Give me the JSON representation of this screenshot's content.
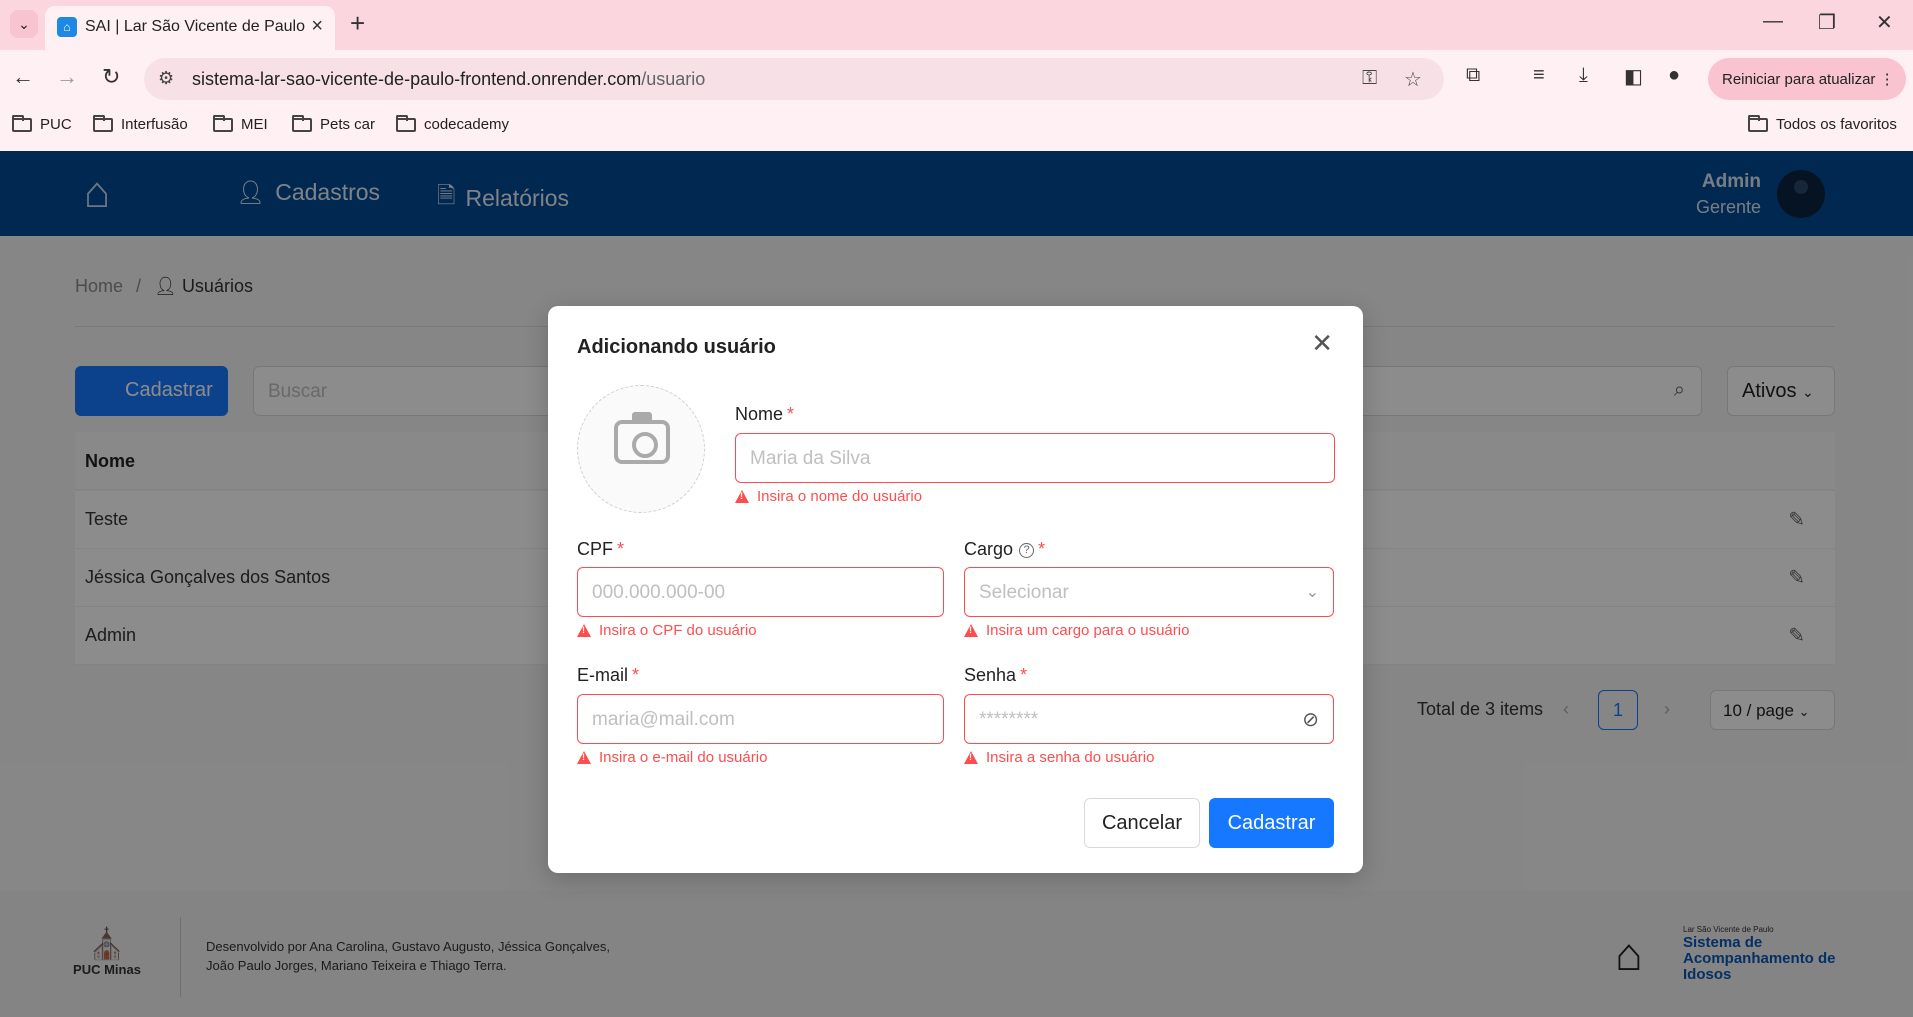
{
  "browser": {
    "tab_title": "SAI | Lar São Vicente de Paulo",
    "url_host": "sistema-lar-sao-vicente-de-paulo-frontend.onrender.com",
    "url_path": "/usuario",
    "update_label": "Reiniciar para atualizar",
    "bookmarks": [
      "PUC",
      "Interfusão",
      "MEI",
      "Pets car",
      "codecademy"
    ],
    "all_bookmarks": "Todos os favoritos"
  },
  "header": {
    "nav": [
      "Cadastros",
      "Relatórios"
    ],
    "user_name": "Admin",
    "user_role": "Gerente"
  },
  "breadcrumb": {
    "home": "Home",
    "separator": "/",
    "current": "Usuários"
  },
  "toolbar": {
    "add_label": "Cadastrar",
    "search_placeholder": "Buscar",
    "status_filter": "Ativos"
  },
  "table": {
    "header_name": "Nome",
    "rows": [
      "Teste",
      "Jéssica Gonçalves dos Santos",
      "Admin"
    ]
  },
  "pagination": {
    "total": "Total de 3 items",
    "current": "1",
    "page_size": "10 / page"
  },
  "footer": {
    "puc": "PUC Minas",
    "credits": "Desenvolvido por Ana Carolina, Gustavo Augusto, Jéssica Gonçalves, João Paulo Jorges, Mariano Teixeira e Thiago Terra.",
    "sai_small": "Lar São Vicente de Paulo",
    "sai_title": "Sistema de Acompanhamento de Idosos"
  },
  "modal": {
    "title": "Adicionando usuário",
    "nome_label": "Nome",
    "nome_placeholder": "Maria da Silva",
    "nome_error": "Insira o nome do usuário",
    "cpf_label": "CPF",
    "cpf_placeholder": "000.000.000-00",
    "cpf_error": "Insira o CPF do usuário",
    "cargo_label": "Cargo",
    "cargo_placeholder": "Selecionar",
    "cargo_error": "Insira um cargo para o usuário",
    "email_label": "E-mail",
    "email_placeholder": "maria@mail.com",
    "email_error": "Insira o e-mail do usuário",
    "senha_label": "Senha",
    "senha_placeholder": "********",
    "senha_error": "Insira a senha do usuário",
    "cancel": "Cancelar",
    "submit": "Cadastrar",
    "required_mark": "*"
  },
  "colors": {
    "primary": "#1677ff",
    "header": "#004a93",
    "error": "#ff4d4f",
    "chrome": "#fbd6df"
  }
}
